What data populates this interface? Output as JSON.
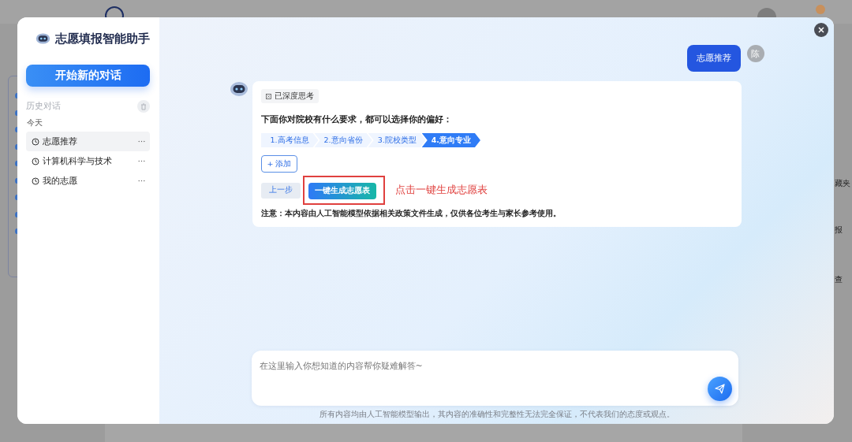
{
  "background_page": {
    "side_fragments": [
      "藏夹",
      "报",
      "查"
    ]
  },
  "assistant": {
    "title": "志愿填报智能助手",
    "new_chat": "开始新的对话",
    "history_label": "历史对话",
    "group_label": "今天",
    "history": [
      {
        "title": "志愿推荐",
        "selected": true
      },
      {
        "title": "计算机科学与技术",
        "selected": false
      },
      {
        "title": "我的志愿",
        "selected": false
      }
    ]
  },
  "chat": {
    "user_message": "志愿推荐",
    "user_avatar": "陈",
    "thinking_badge": "已深度思考",
    "prompt": "下面你对院校有什么要求，都可以选择你的偏好：",
    "steps": [
      {
        "label": "1.高考信息",
        "selected": false
      },
      {
        "label": "2.意向省份",
        "selected": false
      },
      {
        "label": "3.院校类型",
        "selected": false
      },
      {
        "label": "4.意向专业",
        "selected": true
      }
    ],
    "add_button": "+ 添加",
    "back_button": "上一步",
    "generate_button": "一键生成志愿表",
    "annotation": "点击一键生成志愿表",
    "notice": "注意：本内容由人工智能模型依据相关政策文件生成，仅供各位考生与家长参考使用。"
  },
  "input": {
    "placeholder": "在这里输入你想知道的内容帮你疑难解答~"
  },
  "disclaimer": "所有内容均由人工智能模型输出，其内容的准确性和完整性无法完全保证，不代表我们的态度或观点。"
}
